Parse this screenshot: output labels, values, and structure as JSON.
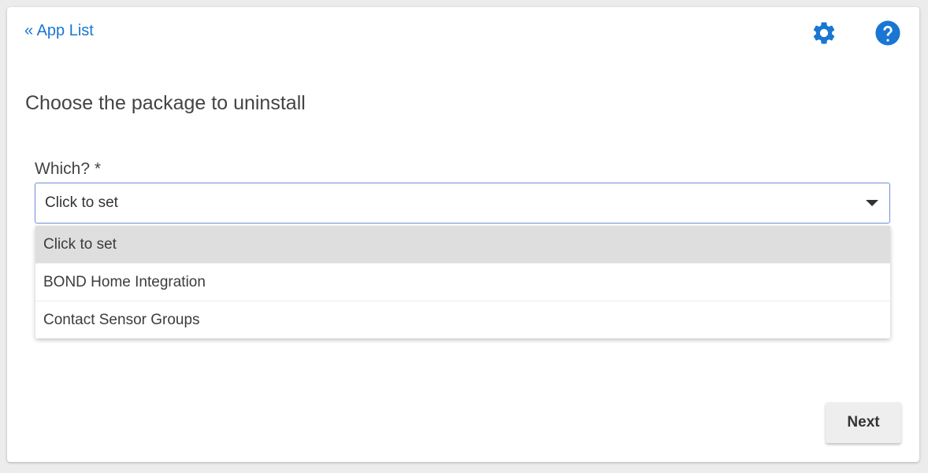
{
  "nav": {
    "back_label": "« App List"
  },
  "toolbar": {
    "settings_icon": "gear-icon",
    "help_icon": "help-icon",
    "accent_color": "#1976d2"
  },
  "page": {
    "title": "Choose the package to uninstall"
  },
  "field": {
    "label": "Which? *",
    "value": "Click to set",
    "options": [
      {
        "label": "Click to set",
        "selected": true
      },
      {
        "label": "BOND Home Integration",
        "selected": false
      },
      {
        "label": "Contact Sensor Groups",
        "selected": false
      }
    ]
  },
  "actions": {
    "next_label": "Next"
  }
}
